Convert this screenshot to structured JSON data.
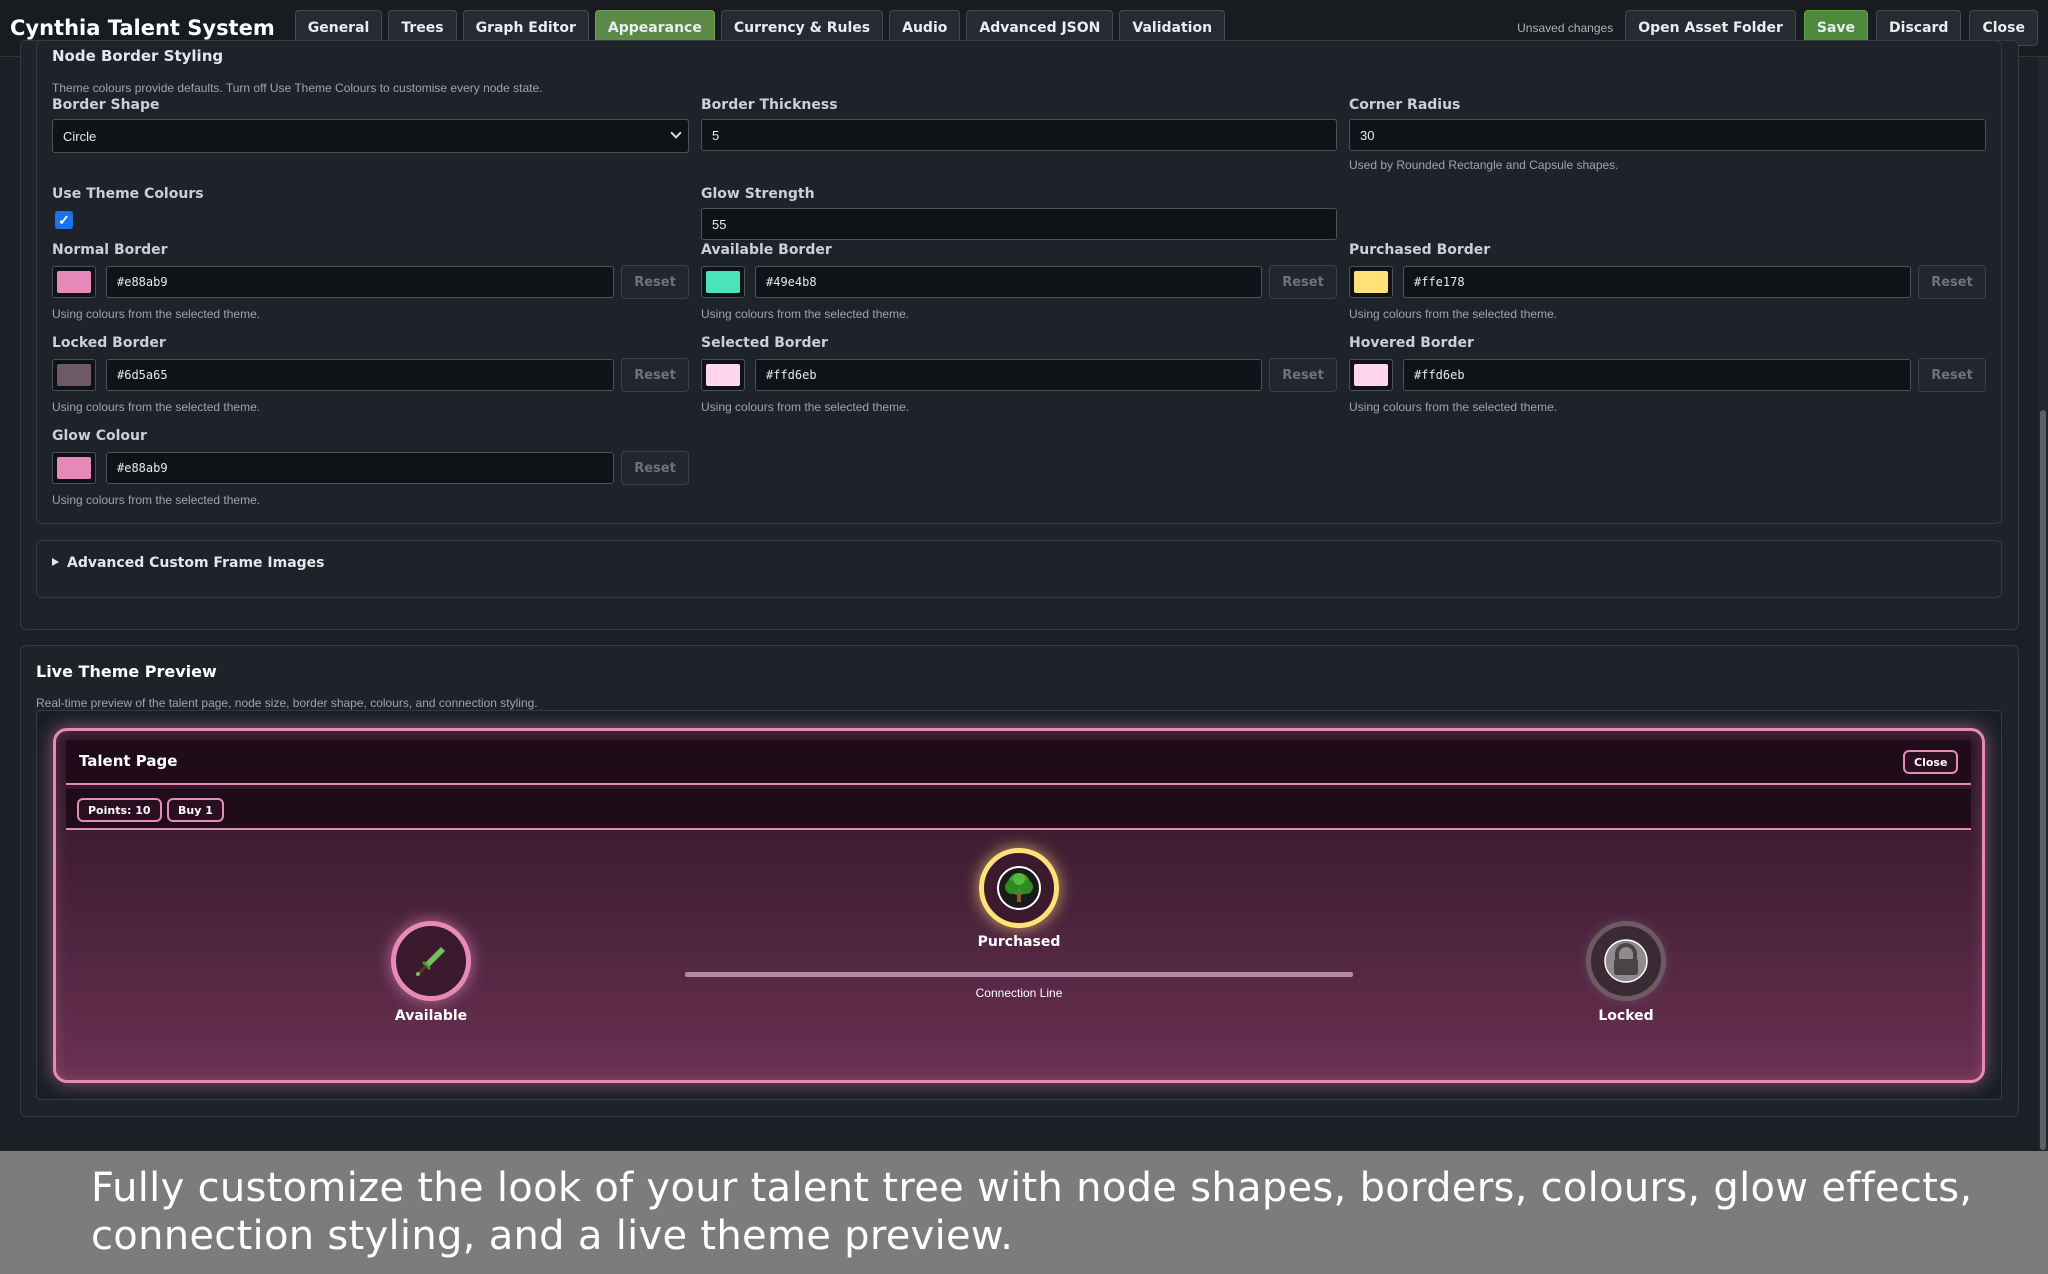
{
  "app": {
    "title": "Cynthia Talent System"
  },
  "tabs": [
    {
      "label": "General",
      "active": false
    },
    {
      "label": "Trees",
      "active": false
    },
    {
      "label": "Graph Editor",
      "active": false
    },
    {
      "label": "Appearance",
      "active": true
    },
    {
      "label": "Currency & Rules",
      "active": false
    },
    {
      "label": "Audio",
      "active": false
    },
    {
      "label": "Advanced JSON",
      "active": false
    },
    {
      "label": "Validation",
      "active": false
    }
  ],
  "toolbar": {
    "status": "Unsaved changes",
    "open_asset_folder": "Open Asset Folder",
    "save": "Save",
    "discard": "Discard",
    "close": "Close"
  },
  "border_styling": {
    "heading": "Node Border Styling",
    "hint": "Theme colours provide defaults. Turn off Use Theme Colours to customise every node state.",
    "border_shape": {
      "label": "Border Shape",
      "value": "Circle"
    },
    "border_thickness": {
      "label": "Border Thickness",
      "value": "5"
    },
    "corner_radius": {
      "label": "Corner Radius",
      "value": "30",
      "hint": "Used by Rounded Rectangle and Capsule shapes."
    },
    "use_theme_colours": {
      "label": "Use Theme Colours",
      "checked": true,
      "glyph": "✓"
    },
    "glow_strength": {
      "label": "Glow Strength",
      "value": "55"
    },
    "reset_label": "Reset",
    "theme_hint": "Using colours from the selected theme.",
    "colours": {
      "normal": {
        "label": "Normal Border",
        "value": "#e88ab9"
      },
      "available": {
        "label": "Available Border",
        "value": "#49e4b8"
      },
      "purchased": {
        "label": "Purchased Border",
        "value": "#ffe178"
      },
      "locked": {
        "label": "Locked Border",
        "value": "#6d5a65"
      },
      "selected": {
        "label": "Selected Border",
        "value": "#ffd6eb"
      },
      "hovered": {
        "label": "Hovered Border",
        "value": "#ffd6eb"
      },
      "glow": {
        "label": "Glow Colour",
        "value": "#e88ab9"
      }
    }
  },
  "advanced_frames": {
    "label": "Advanced Custom Frame Images",
    "expanded": false
  },
  "preview": {
    "title": "Live Theme Preview",
    "hint": "Real-time preview of the talent page, node size, border shape, colours, and connection styling.",
    "page_title": "Talent Page",
    "close": "Close",
    "points": "Points: 10",
    "buy": "Buy 1",
    "nodes": {
      "available": {
        "label": "Available",
        "icon": "sword-icon"
      },
      "purchased": {
        "label": "Purchased",
        "icon": "tree-icon"
      },
      "locked": {
        "label": "Locked",
        "icon": "padlock-icon"
      }
    },
    "connection_label": "Connection Line"
  },
  "caption": "Fully customize the look of your talent tree with node shapes, borders, colours, glow effects, connection styling, and a live theme preview."
}
